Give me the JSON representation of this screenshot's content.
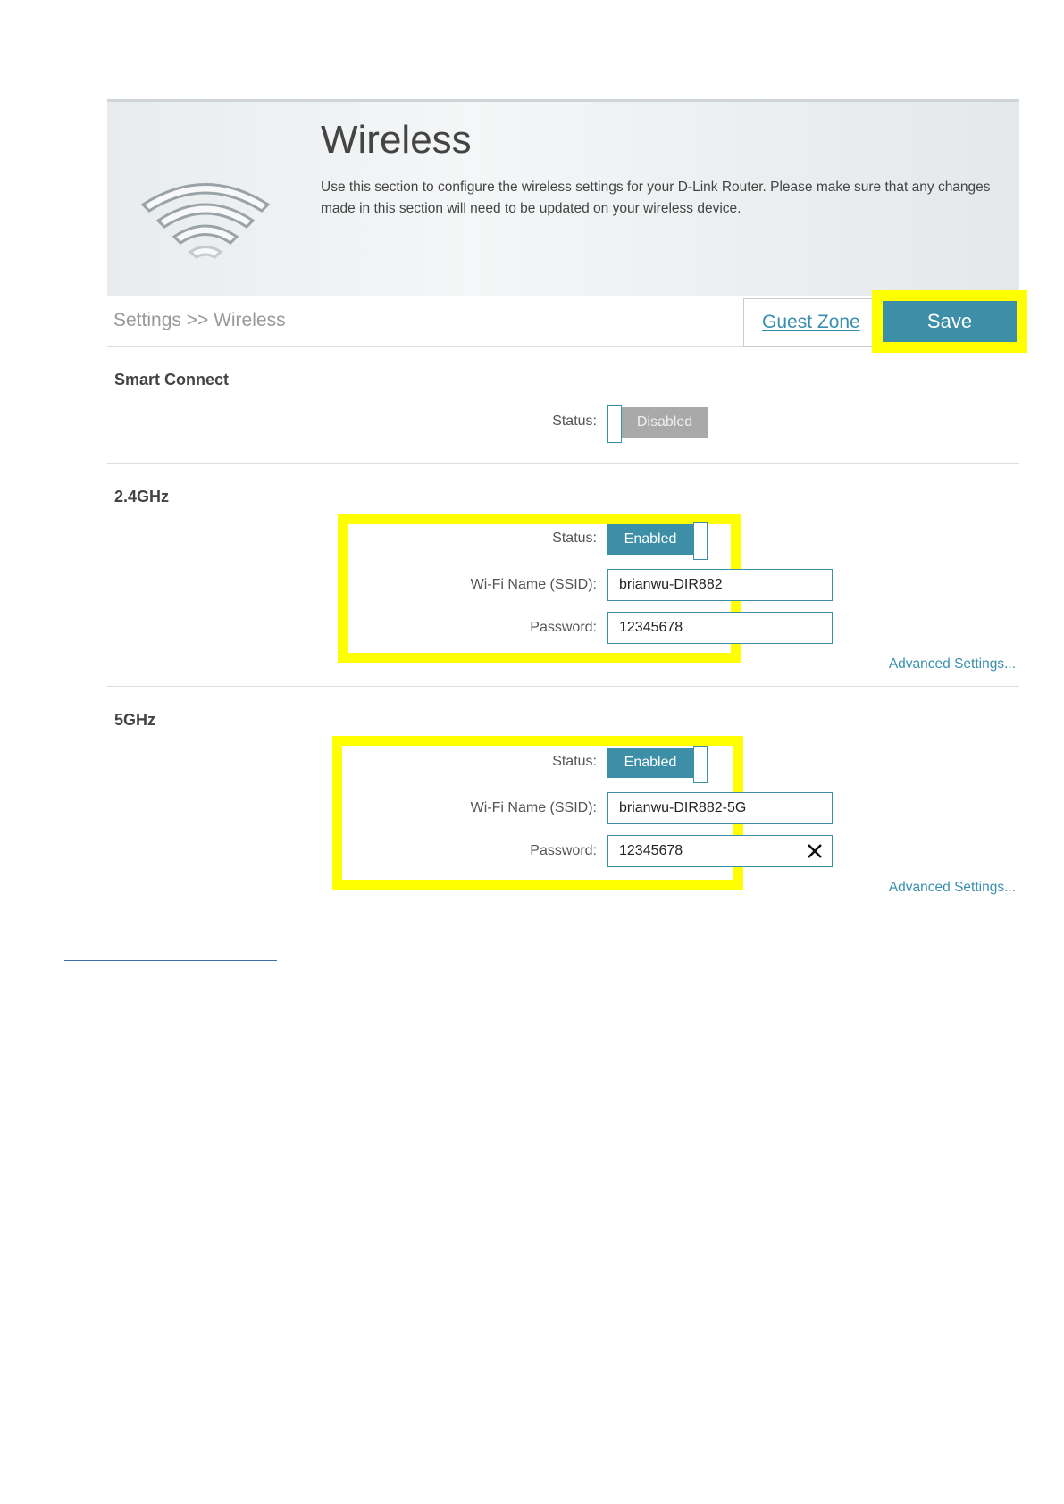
{
  "header": {
    "title": "Wireless",
    "description": "Use this section to configure the wireless settings for your D-Link Router. Please make sure that any changes made in this section will need to be updated on your wireless device.",
    "icon": "wifi-icon"
  },
  "bar": {
    "breadcrumb": "Settings >> Wireless",
    "guest_zone_label": "Guest Zone",
    "save_label": "Save"
  },
  "smart_connect": {
    "title": "Smart Connect",
    "status_label": "Status:",
    "status_value": "Disabled"
  },
  "band_24": {
    "title": "2.4GHz",
    "status_label": "Status:",
    "status_value": "Enabled",
    "ssid_label": "Wi-Fi Name (SSID):",
    "ssid_value": "brianwu-DIR882",
    "password_label": "Password:",
    "password_value": "12345678",
    "advanced_label": "Advanced Settings..."
  },
  "band_5": {
    "title": "5GHz",
    "status_label": "Status:",
    "status_value": "Enabled",
    "ssid_label": "Wi-Fi Name (SSID):",
    "ssid_value": "brianwu-DIR882-5G",
    "password_label": "Password:",
    "password_value": "12345678",
    "advanced_label": "Advanced Settings..."
  },
  "colors": {
    "accent": "#3d8fa8",
    "highlight": "#ffff00",
    "disabled": "#a9a9a9"
  }
}
